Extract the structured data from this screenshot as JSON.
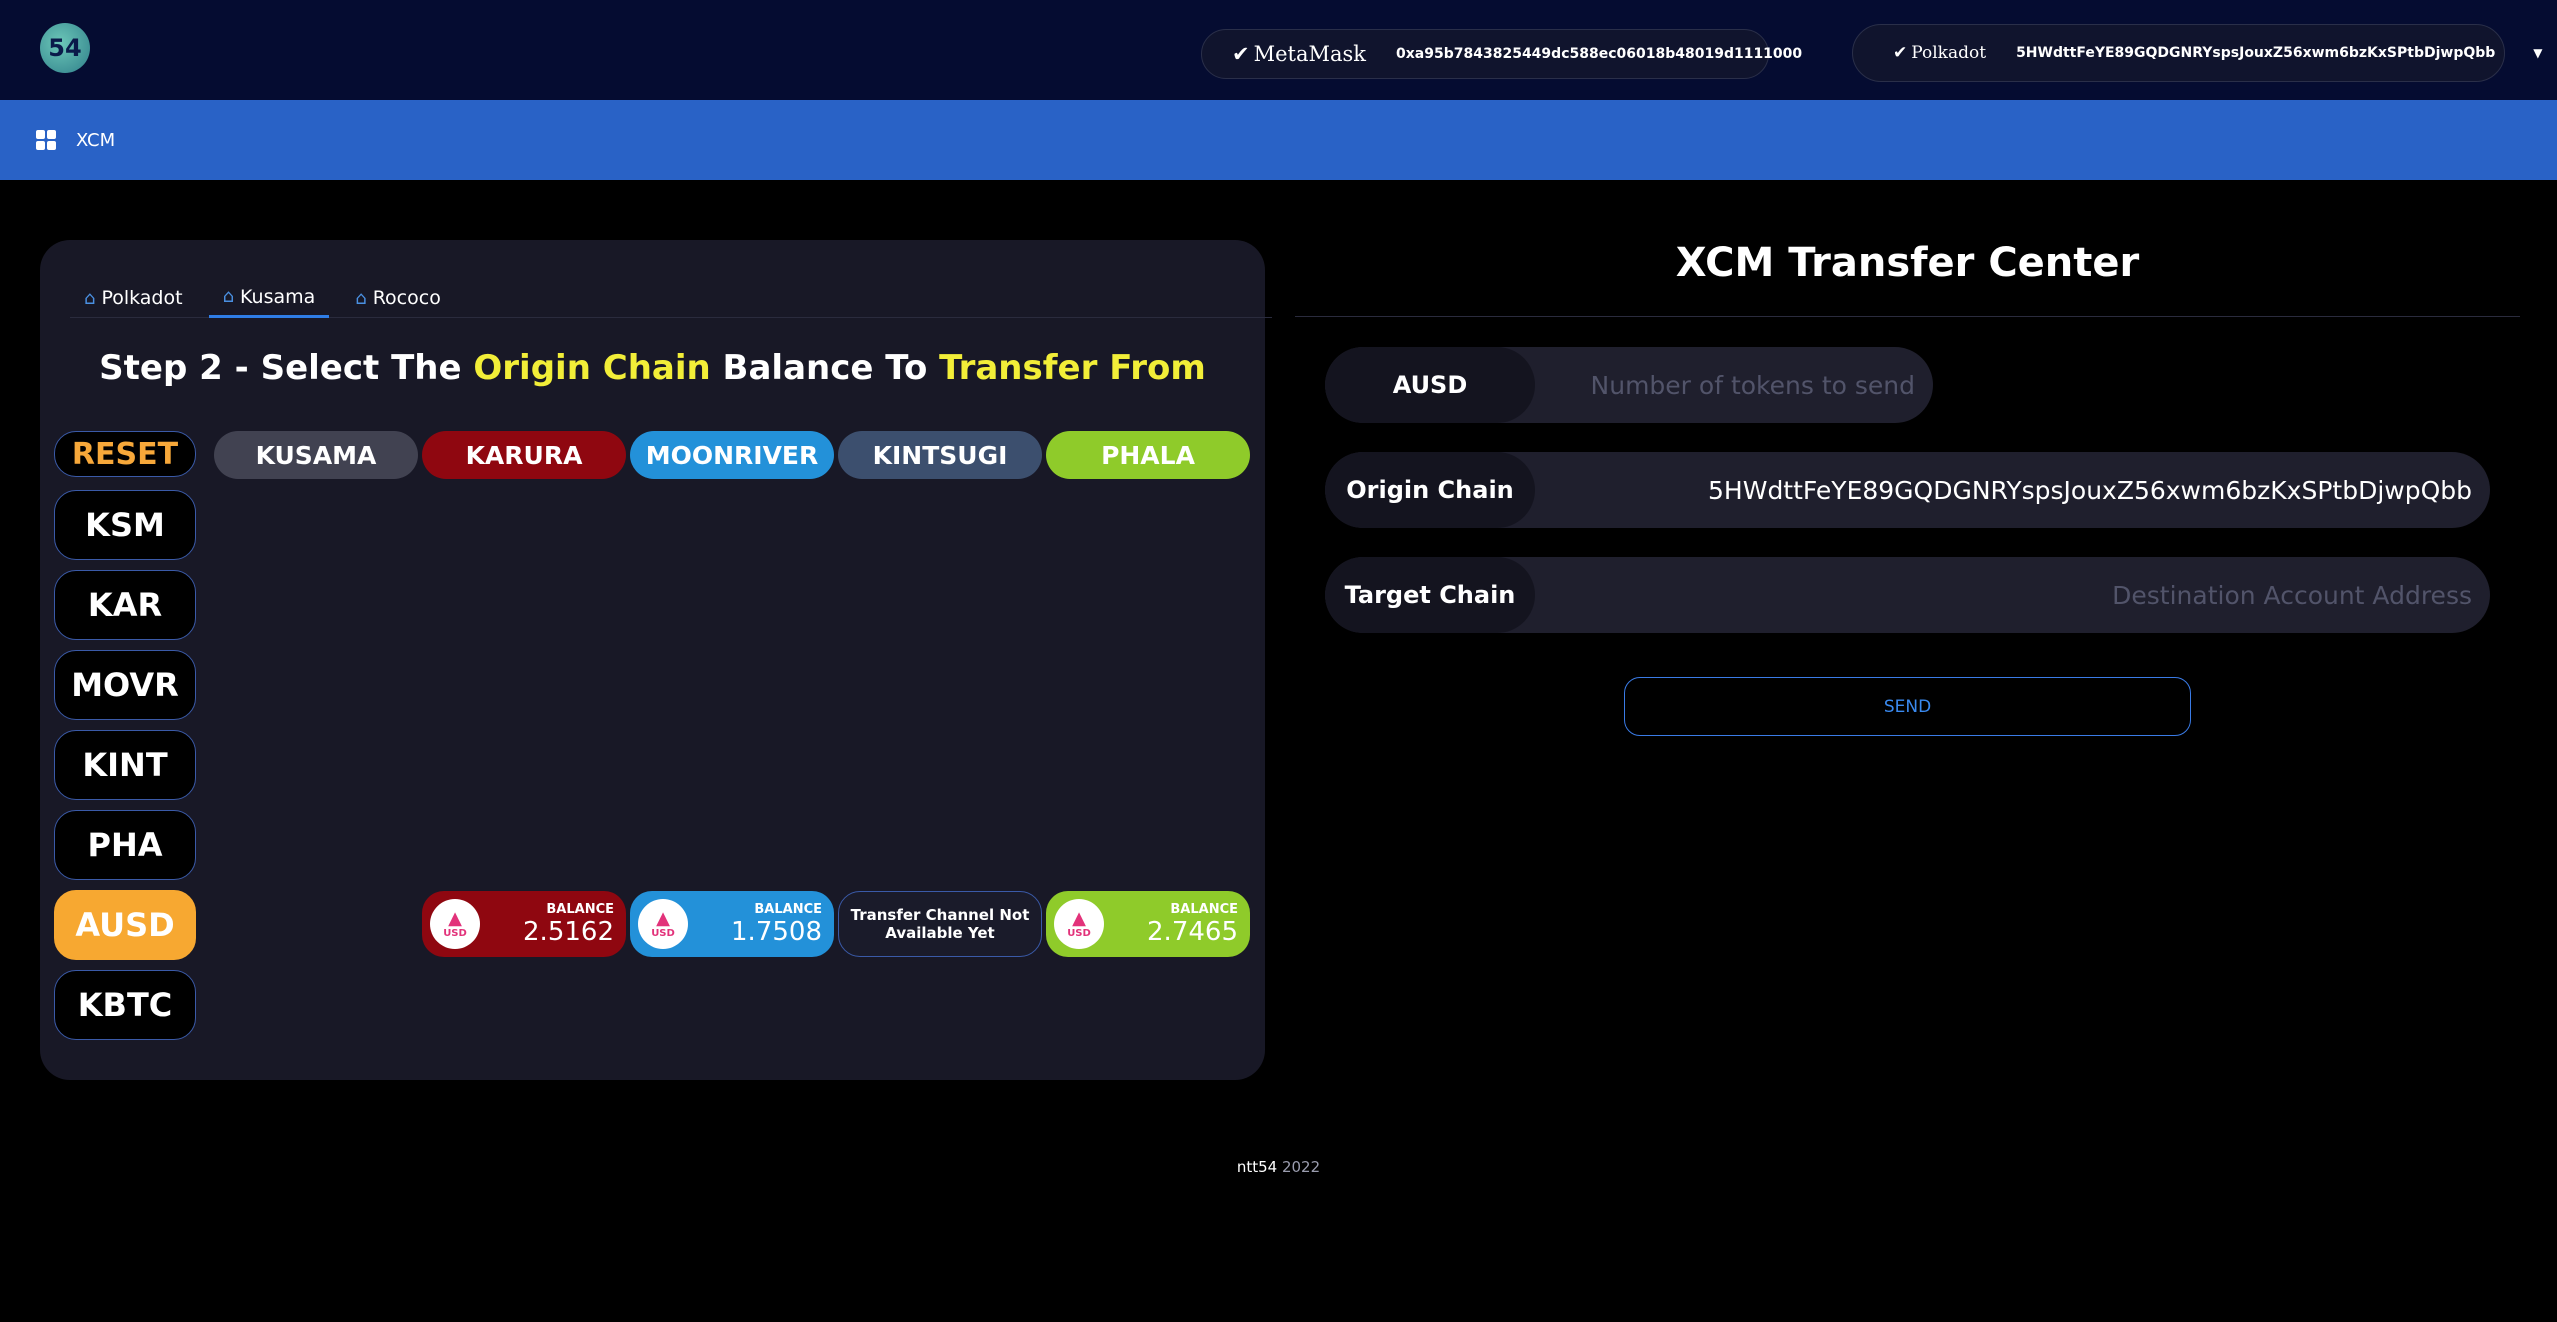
{
  "header": {
    "logo_text": "54",
    "metamask": {
      "brand": "MetaMask",
      "address": "0xa95b7843825449dc588ec06018b48019d1111000"
    },
    "polkadot": {
      "brand": "Polkadot",
      "address": "5HWdttFeYE89GQDGNRYspsJouxZ56xwm6bzKxSPtbDjwpQbb"
    }
  },
  "nav": {
    "label": "XCM"
  },
  "left_panel": {
    "tabs": [
      {
        "label": "Polkadot",
        "active": false
      },
      {
        "label": "Kusama",
        "active": true
      },
      {
        "label": "Rococo",
        "active": false
      }
    ],
    "step_title": {
      "part1": "Step 2 - Select The ",
      "highlight1": "Origin Chain",
      "part2": " Balance To ",
      "highlight2": "Transfer From"
    },
    "reset_label": "RESET",
    "tokens": [
      "KSM",
      "KAR",
      "MOVR",
      "KINT",
      "PHA",
      "AUSD",
      "KBTC"
    ],
    "active_token": "AUSD",
    "chains": [
      {
        "label": "KUSAMA",
        "color": "#414251"
      },
      {
        "label": "KARURA",
        "color": "#8f0710"
      },
      {
        "label": "MOONRIVER",
        "color": "#2391d9"
      },
      {
        "label": "KINTSUGI",
        "color": "#3c4f6e"
      },
      {
        "label": "PHALA",
        "color": "#8fcb2a"
      }
    ],
    "balances": {
      "label": "BALANCE",
      "coin_label": "USD",
      "karura": "2.5162",
      "moonriver": "1.7508",
      "kintsugi": "Transfer Channel Not Available Yet",
      "phala": "2.7465"
    }
  },
  "right_panel": {
    "title": "XCM Transfer Center",
    "amount": {
      "token": "AUSD",
      "placeholder": "Number of tokens to send"
    },
    "origin": {
      "label": "Origin Chain",
      "value": "5HWdttFeYE89GQDGNRYspsJouxZ56xwm6bzKxSPtbDjwpQbb"
    },
    "target": {
      "label": "Target Chain",
      "placeholder": "Destination Account Address"
    },
    "send_label": "SEND"
  },
  "footer": {
    "brand": "ntt54",
    "year": "2022"
  }
}
